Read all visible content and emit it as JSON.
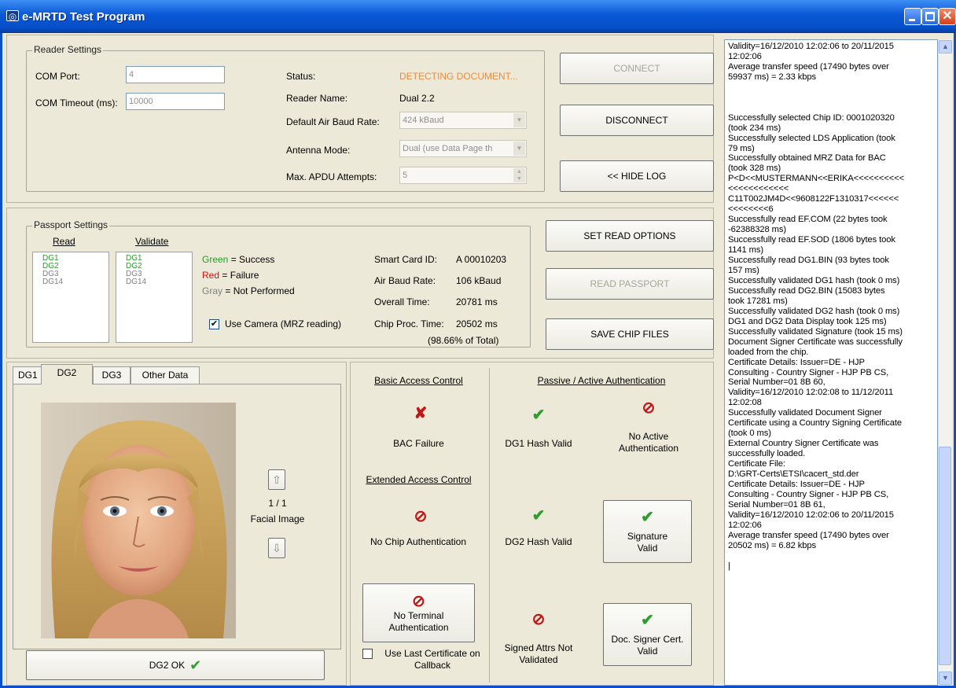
{
  "window": {
    "title": "e-MRTD Test Program"
  },
  "reader": {
    "legend": "Reader Settings",
    "com_port_label": "COM Port:",
    "com_port_value": "4",
    "com_timeout_label": "COM Timeout (ms):",
    "com_timeout_value": "10000",
    "status_label": "Status:",
    "status_value": "DETECTING DOCUMENT...",
    "reader_name_label": "Reader Name:",
    "reader_name_value": "Dual 2.2",
    "baud_label": "Default Air Baud Rate:",
    "baud_value": "424 kBaud",
    "antenna_label": "Antenna Mode:",
    "antenna_value": "Dual (use Data Page th",
    "apdu_label": "Max. APDU Attempts:",
    "apdu_value": "5",
    "connect": "CONNECT",
    "disconnect": "DISCONNECT",
    "hide_log": "<< HIDE LOG"
  },
  "passport": {
    "legend": "Passport Settings",
    "read_header": "Read",
    "validate_header": "Validate",
    "read_list": [
      {
        "label": "DG1",
        "state": "ok"
      },
      {
        "label": "DG2",
        "state": "ok"
      },
      {
        "label": "DG3",
        "state": "gray"
      },
      {
        "label": "DG14",
        "state": "gray"
      }
    ],
    "validate_list": [
      {
        "label": "DG1",
        "state": "ok"
      },
      {
        "label": "DG2",
        "state": "ok"
      },
      {
        "label": "DG3",
        "state": "gray"
      },
      {
        "label": "DG14",
        "state": "gray"
      }
    ],
    "legend_green": "Green",
    "legend_green_text": " = Success",
    "legend_red": "Red",
    "legend_red_text": " = Failure",
    "legend_gray": "Gray",
    "legend_gray_text": " = Not Performed",
    "use_camera": "Use Camera (MRZ reading)",
    "use_camera_checked": true,
    "smartcard_label": "Smart Card ID:",
    "smartcard_value": "A 00010203",
    "airbaud_label": "Air Baud Rate:",
    "airbaud_value": "106 kBaud",
    "overall_label": "Overall Time:",
    "overall_value": "20781 ms",
    "chip_label": "Chip Proc. Time:",
    "chip_value": "20502 ms",
    "chip_pct": "(98.66% of Total)",
    "set_read_options": "SET READ OPTIONS",
    "read_passport": "READ PASSPORT",
    "save_chip_files": "SAVE CHIP FILES"
  },
  "tabs": [
    {
      "label": "DG1"
    },
    {
      "label": "DG2",
      "active": true
    },
    {
      "label": "DG3"
    },
    {
      "label": "Other Data"
    }
  ],
  "image_panel": {
    "counter": "1 / 1",
    "caption": "Facial Image",
    "status_button": "DG2 OK"
  },
  "auth": {
    "bac_header": "Basic Access Control",
    "bac_status": "BAC Failure",
    "bac_icon": "cross-icon",
    "eac_header": "Extended Access Control",
    "chip_auth": "No Chip Authentication",
    "terminal_auth": "No Terminal Authentication",
    "use_last_cert": "Use Last Certificate on Callback",
    "pa_header": "Passive / Active Authentication",
    "dg1_hash": "DG1 Hash Valid",
    "active_auth": "No Active Authentication",
    "dg2_hash": "DG2 Hash Valid",
    "signature": "Signature Valid",
    "signed_attrs": "Signed Attrs Not Validated",
    "doc_signer": "Doc. Signer Cert. Valid"
  },
  "log": {
    "text": "Validity=16/12/2010 12:02:06 to 20/11/2015\n12:02:06\nAverage transfer speed (17490 bytes over\n59937 ms) = 2.33 kbps\n\n\n\nSuccessfully selected Chip ID: 0001020320\n(took 234 ms)\nSuccessfully selected LDS Application (took\n79 ms)\nSuccessfully obtained MRZ Data for BAC\n(took 328 ms)\nP<D<<MUSTERMANN<<ERIKA<<<<<<<<<<\n<<<<<<<<<<<<\nC11T002JM4D<<9608122F1310317<<<<<<\n<<<<<<<<6\nSuccessfully read EF.COM (22 bytes took\n-62388328 ms)\nSuccessfully read EF.SOD (1806 bytes took\n1141 ms)\nSuccessfully read DG1.BIN (93 bytes took\n157 ms)\nSuccessfully validated DG1 hash (took 0 ms)\nSuccessfully read DG2.BIN (15083 bytes\ntook 17281 ms)\nSuccessfully validated DG2 hash (took 0 ms)\nDG1 and DG2 Data Display took 125 ms)\nSuccessfully validated Signature (took 15 ms)\nDocument Signer Certificate was successfully\nloaded from the chip.\nCertificate Details: Issuer=DE - HJP\nConsulting - Country Signer - HJP PB CS,\nSerial Number=01 8B 60,\nValidity=16/12/2010 12:02:08 to 11/12/2011\n12:02:08\nSuccessfully validated Document Signer\nCertificate using a Country Signing Certificate\n(took 0 ms)\nExternal Country Signer Certificate was\nsuccessfully loaded.\nCertificate File:\nD:\\GRT-Certs\\ETSI\\cacert_std.der\nCertificate Details: Issuer=DE - HJP\nConsulting - Country Signer - HJP PB CS,\nSerial Number=01 8B 61,\nValidity=16/12/2010 12:02:06 to 20/11/2015\n12:02:06\nAverage transfer speed (17490 bytes over\n20502 ms) = 6.82 kbps\n\n|"
  },
  "colors": {
    "accent_status": "#f08a3c",
    "success": "#2a9a2a",
    "failure": "#d01010",
    "titlebar": "#0a58d6"
  }
}
